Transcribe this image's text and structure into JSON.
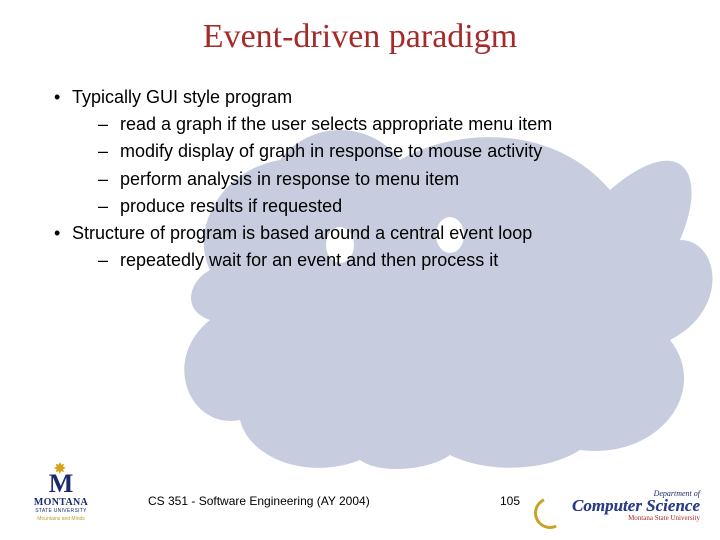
{
  "title": "Event-driven paradigm",
  "bullets": [
    {
      "level": 1,
      "text": "Typically GUI style program"
    },
    {
      "level": 2,
      "text": "read a graph if the user selects appropriate menu item"
    },
    {
      "level": 2,
      "text": "modify display of graph in response to mouse activity"
    },
    {
      "level": 2,
      "text": "perform analysis in response to menu item"
    },
    {
      "level": 2,
      "text": "produce results if requested"
    },
    {
      "level": 1,
      "text": "Structure of program is based around a central event loop"
    },
    {
      "level": 2,
      "text": "repeatedly wait for an event and then process it"
    }
  ],
  "footer": {
    "course": "CS 351 - Software Engineering (AY 2004)",
    "page": "105",
    "msu": {
      "word": "MONTANA",
      "sub": "STATE UNIVERSITY",
      "tag": "Mountains and Minds"
    },
    "cs": {
      "dept": "Department of",
      "name": "Computer Science",
      "uni": "Montana State University"
    }
  }
}
